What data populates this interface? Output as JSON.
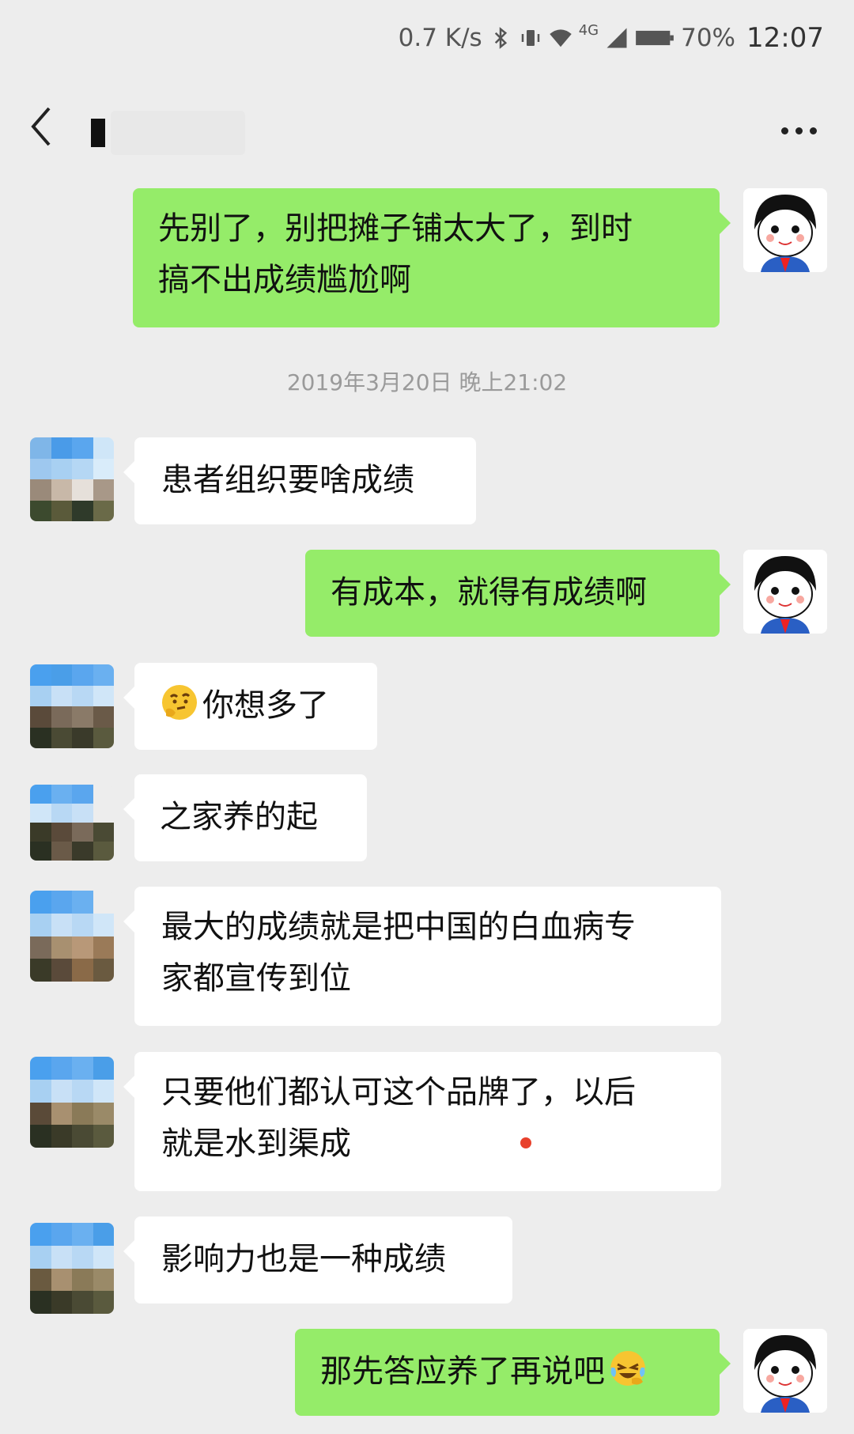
{
  "status_bar": {
    "speed": "0.7 K/s",
    "network": "4G",
    "battery": "70%",
    "time": "12:07",
    "icons": [
      "bluetooth-icon",
      "vibrate-icon",
      "wifi-icon",
      "signal-icon",
      "battery-icon"
    ]
  },
  "header": {
    "title": "",
    "back_icon": "chevron-left-icon",
    "more_icon": "more-dots-icon"
  },
  "messages": [
    {
      "sender": "me",
      "lines": [
        "先别了，别把摊子铺太大了，到时",
        "搞不出成绩尴尬啊"
      ]
    },
    {
      "type": "timestamp",
      "text": "2019年3月20日 晚上21:02"
    },
    {
      "sender": "them",
      "lines": [
        "患者组织要啥成绩"
      ]
    },
    {
      "sender": "me",
      "lines": [
        "有成本，就得有成绩啊"
      ]
    },
    {
      "sender": "them",
      "emoji": "thinking-face-emoji",
      "lines": [
        "你想多了"
      ]
    },
    {
      "sender": "them",
      "lines": [
        "之家养的起"
      ]
    },
    {
      "sender": "them",
      "lines": [
        "最大的成绩就是把中国的白血病专",
        "家都宣传到位"
      ]
    },
    {
      "sender": "them",
      "lines": [
        "只要他们都认可这个品牌了，以后",
        "就是水到渠成"
      ]
    },
    {
      "sender": "them",
      "lines": [
        "影响力也是一种成绩"
      ]
    },
    {
      "sender": "me",
      "emoji": "laughing-tears-emoji",
      "lines": [
        "那先答应养了再说吧"
      ]
    }
  ],
  "colors": {
    "background": "#ededed",
    "my_bubble": "#95ec69",
    "their_bubble": "#ffffff",
    "timestamp_text": "#9a9a9a"
  }
}
